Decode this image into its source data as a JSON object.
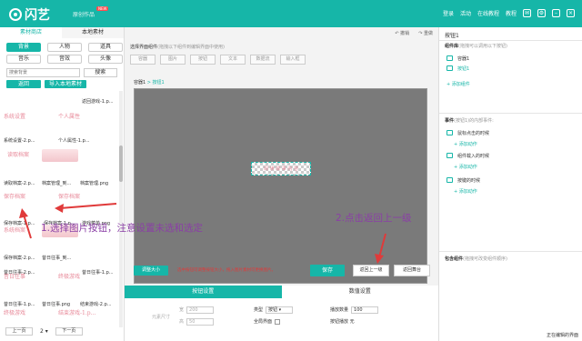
{
  "topbar": {
    "app_name": "闪艺",
    "app_sub": "原创作品",
    "new_badge": "NEW",
    "login": "登录",
    "activity": "活动",
    "online_tutorial": "在线教程",
    "tutorial": "教程",
    "icons": [
      "mail-icon",
      "settings-icon",
      "minimize-icon",
      "close-icon"
    ]
  },
  "left": {
    "tabs": [
      "素材商店",
      "本地素材"
    ],
    "categories": [
      "背景",
      "人物",
      "道具",
      "音乐",
      "音效",
      "头像"
    ],
    "search_placeholder": "搜索背景",
    "search_btn": "搜索",
    "actions": [
      "返回",
      "导入本地素材"
    ],
    "assets": [
      {
        "thumb": "",
        "name": "返回游戏-1.p..."
      },
      {
        "thumb": "系统设置",
        "name": ""
      },
      {
        "thumb": "个人属性",
        "name": ""
      },
      {
        "thumb": "",
        "name": "系统设置-2.p..."
      },
      {
        "thumb": "",
        "name": "个人属性-1.p..."
      },
      {
        "thumb": "读取档案",
        "name": "读取档案-2.p..."
      },
      {
        "thumb": "",
        "name": "读取简单-1.p..."
      },
      {
        "thumb": "读取档案",
        "name": "读取档案-2.p..."
      },
      {
        "thumb": "",
        "name": "档案管理_到..."
      },
      {
        "thumb": "",
        "name": "档案管理.png"
      },
      {
        "thumb": "保存档案",
        "name": "保存档案-1.p..."
      },
      {
        "thumb": "保存档案",
        "name": "保存档案-1.p..."
      },
      {
        "thumb": "",
        "name": "游戏菜单.png"
      },
      {
        "thumb": "系统档案",
        "name": "保存档案-2.p..."
      },
      {
        "thumb": "",
        "name": "昔日往事_到..."
      },
      {
        "thumb": "昔日往事",
        "name": "昔日往事-2.p..."
      },
      {
        "thumb": "",
        "name": "昔日往事-1.p..."
      },
      {
        "thumb": "昔日往事",
        "name": "昔日往事-1.p..."
      },
      {
        "thumb": "",
        "name": "昔日往事.png"
      },
      {
        "thumb": "终极游戏",
        "name": "结束游戏-2.p..."
      },
      {
        "thumb": "终极游戏",
        "name": "结束游戏-1.p..."
      }
    ],
    "pager": {
      "prev": "上一页",
      "page": "2",
      "next": "下一页"
    }
  },
  "center": {
    "undo": "撤销",
    "redo": "重做",
    "pick_title": "选择界面组件",
    "pick_hint": "(拖拽以下组件到编辑界面中使用)",
    "components": [
      "容器",
      "图片",
      "按钮",
      "文本",
      "数据流",
      "输入框"
    ],
    "container_label": "容器1",
    "container_link": "> 按钮1",
    "selected_button": "阅 读 故 事 内 容",
    "resize_btn": "调整大小",
    "hint_red": "选中按钮可调整按钮大小，拖入图片素材可更换图片。",
    "save": "保存",
    "back_one": "返回上一级",
    "back_stage": "返回舞台",
    "tabs": [
      "按钮设置",
      "数值设置"
    ],
    "props": {
      "size_label": "元素尺寸",
      "w_label": "宽",
      "w_value": "200",
      "h_label": "高",
      "h_value": "50",
      "type_label": "类型",
      "type_value": "按钮",
      "fullscreen_label": "全局界面",
      "count_label": "播放数量",
      "count_value": "100",
      "effect_label": "按钮播放",
      "effect_value": "无"
    }
  },
  "right": {
    "title": "按钮1",
    "comp_lib": "组件库",
    "comp_lib_hint": "(拖拽可以调用以下按钮)",
    "tree": [
      "容器1",
      "按钮1"
    ],
    "add_comp": "+ 添加组件",
    "events_title": "事件",
    "events_hint": "(按钮1)的内部事件:",
    "events": [
      "鼠标点击的时候",
      "组件载入的时候",
      "按键的时候"
    ],
    "add_action": "+ 添加动作",
    "include": "包含组件",
    "include_hint": "(拖拽可改变组件顺序)",
    "bottom_link": "正在编辑的界面"
  },
  "annotations": {
    "a1": "1.选择图片按钮，注意设置未选和选定",
    "a2": "2.点击返回上一级"
  },
  "colors": {
    "accent": "#16b6a8",
    "annotation": "#8b3fa6",
    "arrow": "#e03a3a"
  }
}
